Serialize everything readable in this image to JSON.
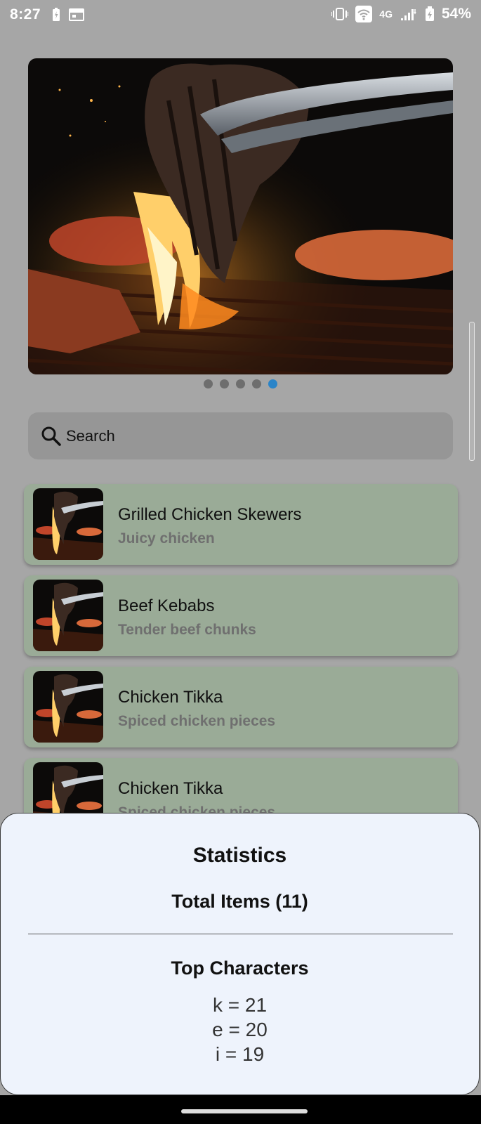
{
  "status_bar": {
    "time": "8:27",
    "network": "4G",
    "battery": "54%"
  },
  "carousel": {
    "image": "grilled-steak-photo",
    "dots_total": 5,
    "active_dot": 5
  },
  "search": {
    "placeholder": "Search"
  },
  "items": [
    {
      "title": "Grilled Chicken Skewers",
      "subtitle": "Juicy chicken"
    },
    {
      "title": "Beef Kebabs",
      "subtitle": "Tender beef chunks"
    },
    {
      "title": "Chicken Tikka",
      "subtitle": "Spiced chicken pieces"
    },
    {
      "title": "Chicken Tikka",
      "subtitle": "Spiced chicken pieces"
    }
  ],
  "stats": {
    "title": "Statistics",
    "total_items": "Total Items (11)",
    "top_characters_heading": "Top Characters",
    "top_characters": [
      "k = 21",
      "e = 20",
      "i = 19"
    ]
  },
  "colors": {
    "card_background": "#9aab97",
    "active_dot": "#2a84c8",
    "sheet_background": "#eef3fc"
  }
}
